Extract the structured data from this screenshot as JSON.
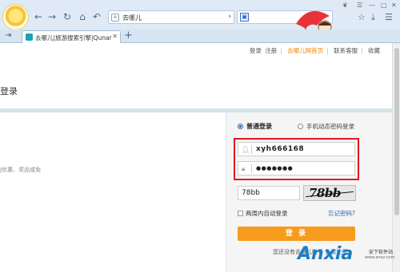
{
  "browser": {
    "address_url": "去哪儿",
    "tab_title": "去哪儿|旅游搜索引擎|Qunar",
    "new_tab_symbol": "+"
  },
  "page": {
    "top_links": {
      "login": "登录",
      "register": "注册",
      "qunar_home": "去哪儿网首页",
      "customer_service": "联系客服",
      "favorite": "收藏"
    },
    "title": "登录",
    "promo_text": "J优惠、奖品或免",
    "login": {
      "mode_normal": "普通登录",
      "mode_sms": "手机动态密码登录",
      "username_value": "xyh666168",
      "password_value": "●●●●●●●",
      "captcha_value": "78bb",
      "captcha_image_text": "78bb",
      "auto_login": "两周内自动登录",
      "forgot_password": "忘记密码?",
      "submit": "登 录",
      "register_prompt": "您还没有去哪儿帐号",
      "register_link": "免费注册"
    }
  },
  "watermark": {
    "brand": "Anxia",
    "brand_suffix": ".com",
    "tagline": "安下软件站",
    "url": "www.anxz.com"
  },
  "colors": {
    "accent_orange": "#f79b1c",
    "highlight_red": "#e0171f",
    "link_blue": "#2d5fb0"
  }
}
